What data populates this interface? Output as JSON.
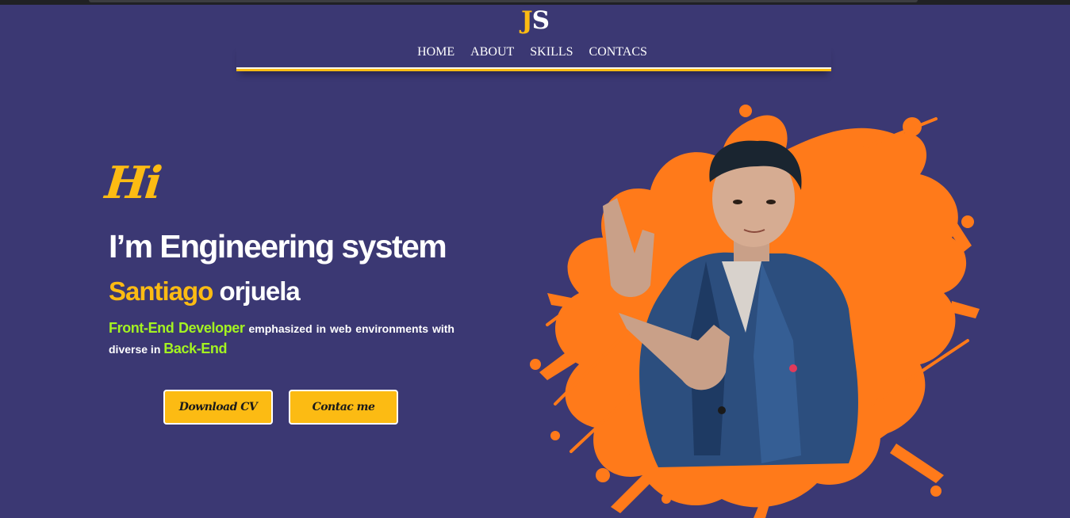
{
  "logo": {
    "first": "J",
    "second": "S"
  },
  "nav": {
    "items": [
      {
        "label": "HOME"
      },
      {
        "label": "ABOUT"
      },
      {
        "label": "SKILLS"
      },
      {
        "label": "CONTACS"
      }
    ]
  },
  "hero": {
    "greeting": "Hi",
    "headline": "I’m Engineering system",
    "name_first": "Santiago",
    "name_last": "orjuela",
    "desc_highlight_1": "Front-End Developer",
    "desc_text_1": "emphasized in web environments with diverse in",
    "desc_highlight_2": "Back-End",
    "buttons": {
      "download_label": "Download CV",
      "contact_label": "Contac me"
    }
  },
  "colors": {
    "background": "#3b3873",
    "accent": "#fcbb13",
    "highlight_green": "#a4f321",
    "splash_orange": "#ff7a1a",
    "text": "#ffffff"
  },
  "icons": {
    "hero_image": "profile-photo-with-paint-splash"
  }
}
